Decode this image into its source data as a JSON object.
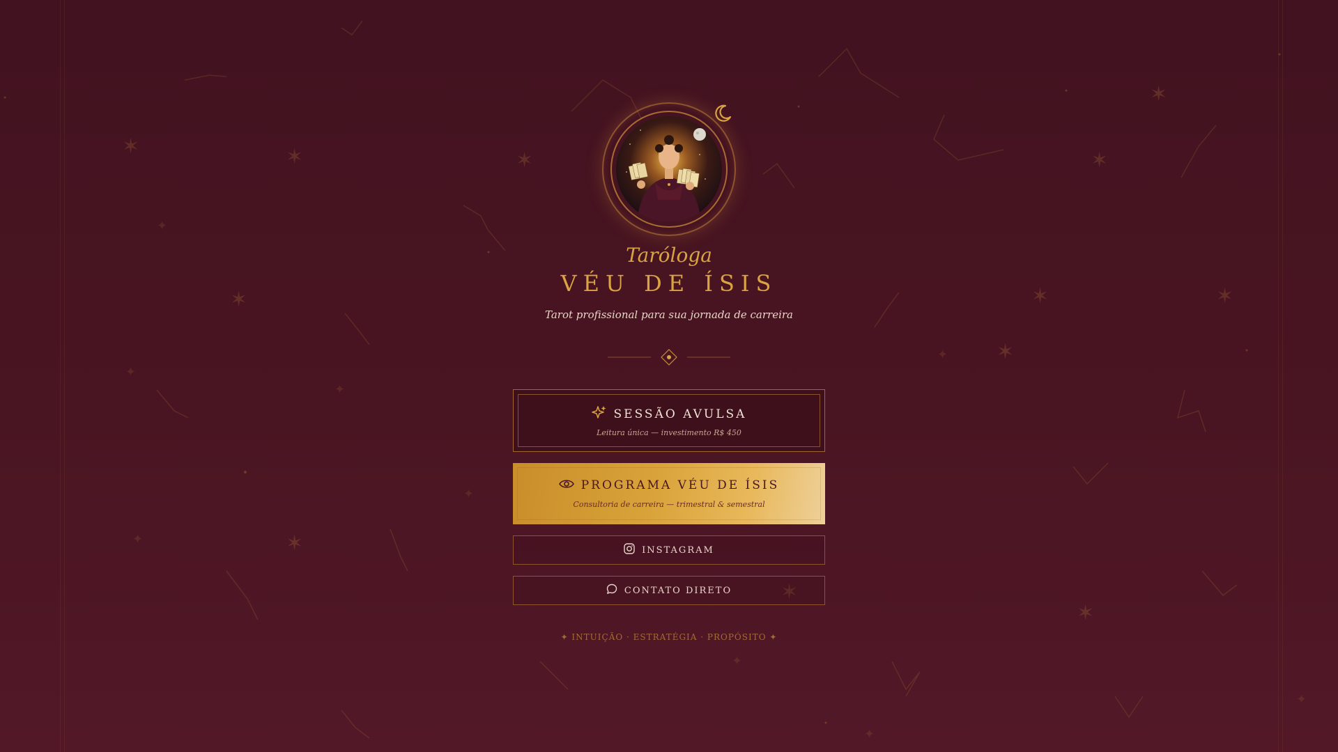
{
  "header": {
    "eyebrow": "Taróloga",
    "title": "VÉU DE ÍSIS",
    "tagline": "Tarot profissional para sua jornada de carreira"
  },
  "buttons": {
    "session": {
      "label": "SESSÃO AVULSA",
      "description": "Leitura única — investimento R$ 450",
      "icon": "sparkle-icon"
    },
    "program": {
      "label": "PROGRAMA VÉU DE ÍSIS",
      "description": "Consultoria de carreira — trimestral & semestral",
      "icon": "eye-icon"
    },
    "instagram": {
      "label": "INSTAGRAM",
      "icon": "instagram-icon"
    },
    "contact": {
      "label": "CONTATO DIRETO",
      "icon": "chat-bubble-icon"
    }
  },
  "footer": {
    "words": "✦ INTUIÇÃO · ESTRATÉGIA · PROPÓSITO ✦"
  },
  "theme": {
    "background": "#4a1522",
    "gold": "#d9a441",
    "cream": "#e9d6c8"
  }
}
